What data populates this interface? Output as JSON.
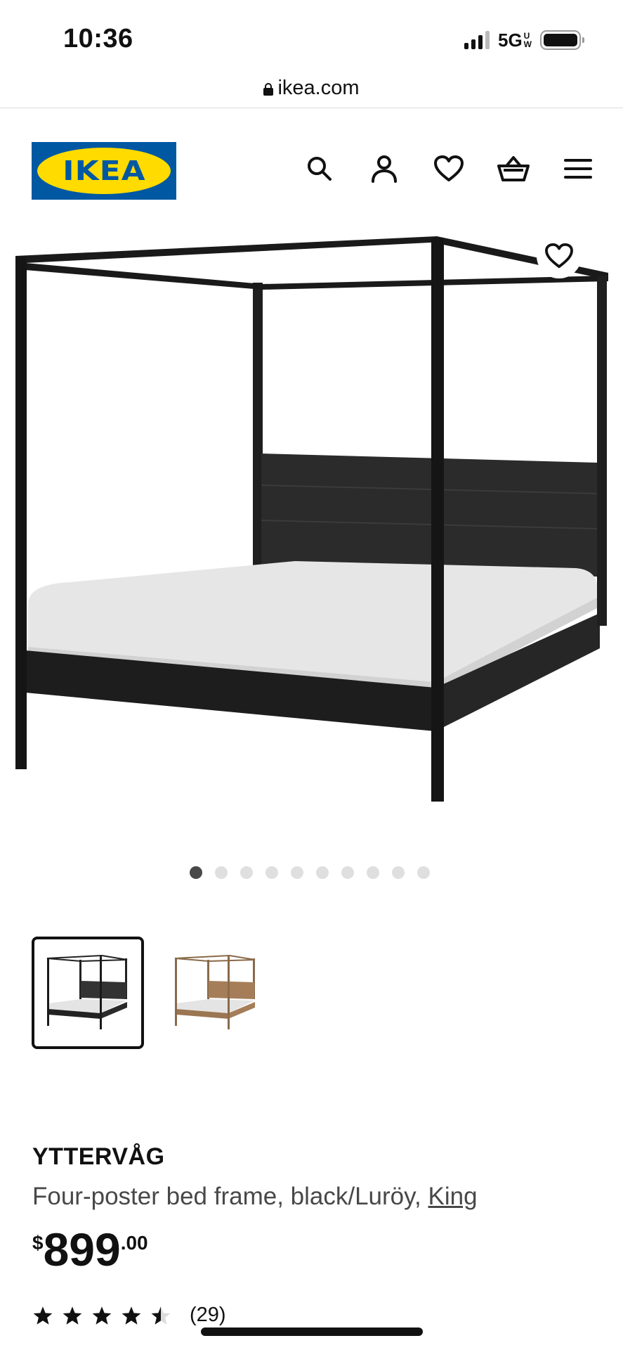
{
  "status_bar": {
    "time": "10:36",
    "network": "5G",
    "network_sup": "UW"
  },
  "browser": {
    "url": "ikea.com"
  },
  "header": {
    "logo_text": "IKEA",
    "brand_blue": "#0058a3",
    "brand_yellow": "#ffdb00",
    "icons": [
      "search-icon",
      "account-icon",
      "favorites-icon",
      "cart-icon",
      "menu-icon"
    ]
  },
  "gallery": {
    "image_count": 10,
    "active_index": 0,
    "thumbnails": [
      {
        "variant": "black",
        "selected": true
      },
      {
        "variant": "wood",
        "selected": false
      }
    ]
  },
  "product": {
    "name": "YTTERVÅG",
    "description": "Four-poster bed frame, black/Luröy, ",
    "size_link": "King",
    "price_currency": "$",
    "price_integer": "899",
    "price_decimal": ".00",
    "rating_value": 4.5,
    "rating_count": "(29)"
  }
}
